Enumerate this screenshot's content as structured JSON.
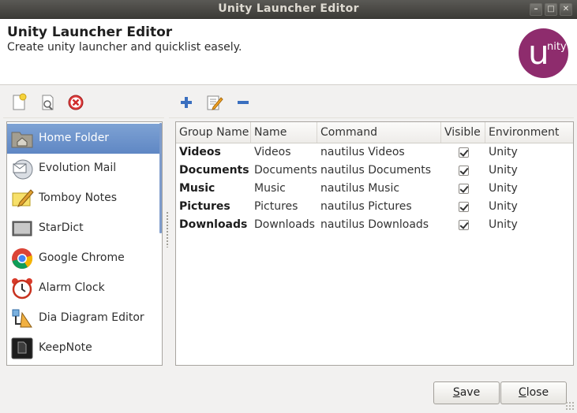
{
  "window": {
    "title": "Unity Launcher Editor"
  },
  "header": {
    "title": "Unity Launcher Editor",
    "subtitle": "Create unity launcher and quicklist easely.",
    "logo_letter": "u",
    "logo_text": "nity"
  },
  "toolbar_left": [
    "new-launcher-icon",
    "edit-launcher-icon",
    "remove-launcher-icon"
  ],
  "toolbar_right": [
    "add-group-icon",
    "edit-group-icon",
    "remove-group-icon"
  ],
  "apps": [
    {
      "label": "Home Folder",
      "icon": "home-folder-icon",
      "selected": true
    },
    {
      "label": "Evolution Mail",
      "icon": "mail-icon"
    },
    {
      "label": "Tomboy Notes",
      "icon": "notes-icon"
    },
    {
      "label": "StarDict",
      "icon": "dictionary-icon"
    },
    {
      "label": "Google Chrome",
      "icon": "chrome-icon"
    },
    {
      "label": "Alarm Clock",
      "icon": "alarm-clock-icon"
    },
    {
      "label": "Dia Diagram Editor",
      "icon": "diagram-icon"
    },
    {
      "label": "KeepNote",
      "icon": "keepnote-icon"
    }
  ],
  "table": {
    "headers": [
      "Group Name",
      "Name",
      "Command",
      "Visible",
      "Environment"
    ],
    "rows": [
      {
        "group": "Videos",
        "name": "Videos",
        "command": "nautilus Videos",
        "visible": true,
        "env": "Unity"
      },
      {
        "group": "Documents",
        "name": "Documents",
        "command": "nautilus Documents",
        "visible": true,
        "env": "Unity"
      },
      {
        "group": "Music",
        "name": "Music",
        "command": "nautilus Music",
        "visible": true,
        "env": "Unity"
      },
      {
        "group": "Pictures",
        "name": "Pictures",
        "command": "nautilus Pictures",
        "visible": true,
        "env": "Unity"
      },
      {
        "group": "Downloads",
        "name": "Downloads",
        "command": "nautilus Downloads",
        "visible": true,
        "env": "Unity"
      }
    ]
  },
  "buttons": {
    "save": {
      "mnemonic": "S",
      "rest": "ave"
    },
    "close": {
      "mnemonic": "C",
      "rest": "lose"
    }
  },
  "colors": {
    "titlebar": "#3c3b37",
    "selection": "#5f87c4",
    "logo": "#8e2c6d"
  }
}
